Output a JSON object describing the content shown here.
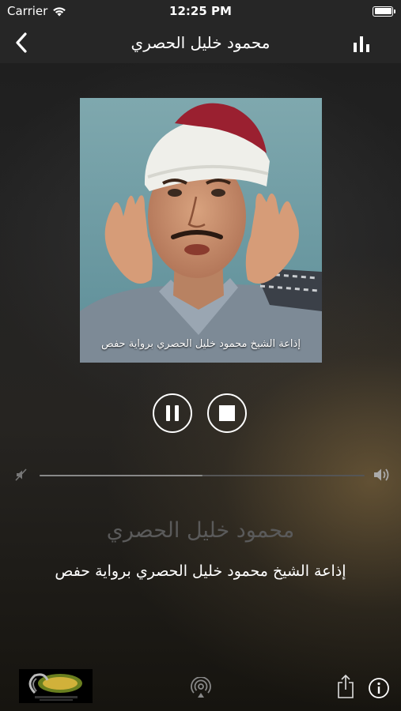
{
  "status_bar": {
    "carrier": "Carrier",
    "time": "12:25 PM"
  },
  "nav": {
    "title": "محمود خليل الحصري"
  },
  "artwork": {
    "caption": "إذاعة الشيخ محمود خليل الحصري برواية حفص"
  },
  "player": {
    "state": "playing",
    "volume_level": 0.5
  },
  "station": {
    "name": "محمود خليل الحصري",
    "description": "إذاعة الشيخ محمود خليل الحصري برواية حفص"
  },
  "icons": {
    "back": "chevron-left-icon",
    "bars": "bar-chart-icon",
    "pause": "pause-icon",
    "stop": "stop-icon",
    "volume_min": "volume-mute-icon",
    "volume_max": "volume-up-icon",
    "airplay": "airplay-icon",
    "share": "share-icon",
    "info": "info-icon"
  },
  "colors": {
    "bar": "#262626",
    "muted_text": "#5a5a5a"
  }
}
